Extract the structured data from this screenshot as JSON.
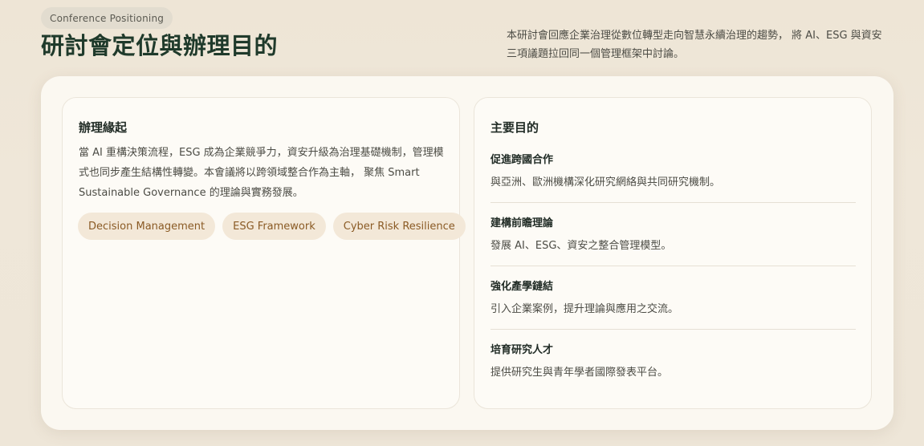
{
  "header": {
    "eyebrow": "Conference Positioning",
    "title": "研討會定位與辦理目的",
    "intro": "本研討會回應企業治理從數位轉型走向智慧永續治理的趨勢， 將 AI、ESG 與資安三項議題拉回同一個管理框架中討論。"
  },
  "background": {
    "heading": "辦理緣起",
    "body": "當 AI 重構決策流程，ESG 成為企業競爭力，資安升級為治理基礎機制，管理模式也同步產生結構性轉變。本會議將以跨領域整合作為主軸， 聚焦 Smart Sustainable Governance 的理論與實務發展。",
    "tags": [
      "Decision Management",
      "ESG Framework",
      "Cyber Risk Resilience"
    ]
  },
  "goals": {
    "heading": "主要目的",
    "items": [
      {
        "title": "促進跨國合作",
        "desc": "與亞洲、歐洲機構深化研究網絡與共同研究機制。"
      },
      {
        "title": "建構前瞻理論",
        "desc": "發展 AI、ESG、資安之整合管理模型。"
      },
      {
        "title": "強化產學鏈結",
        "desc": "引入企業案例，提升理論與應用之交流。"
      },
      {
        "title": "培育研究人才",
        "desc": "提供研究生與青年學者國際發表平台。"
      }
    ]
  }
}
